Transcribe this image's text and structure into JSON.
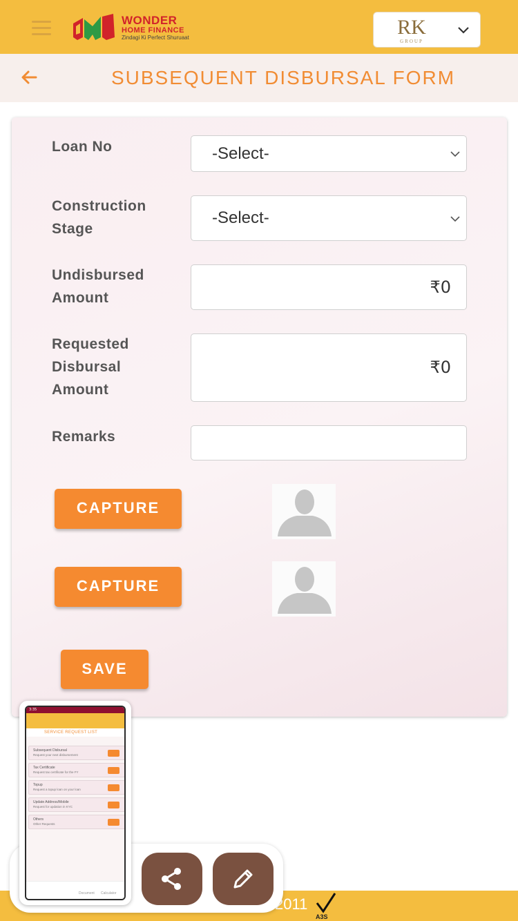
{
  "header": {
    "brand_main": "WONDER",
    "brand_sub": "HOME FINANCE",
    "brand_tagline": "Zindagi Ki Perfect Shuruaat",
    "group_logo_text": "RK",
    "group_logo_sub": "GROUP"
  },
  "page": {
    "title": "SUBSEQUENT DISBURSAL FORM"
  },
  "form": {
    "loan_no": {
      "label": "Loan No",
      "value": "-Select-"
    },
    "construction_stage": {
      "label_line1": "Construction",
      "label_line2": "Stage",
      "value": "-Select-"
    },
    "undisbursed_amount": {
      "label_line1": "Undisbursed",
      "label_line2": "Amount",
      "value": "₹0"
    },
    "requested_amount": {
      "label_line1": "Requested",
      "label_line2": "Disbursal",
      "label_line3": "Amount",
      "value": "₹0"
    },
    "remarks": {
      "label": "Remarks",
      "value": ""
    },
    "capture_label_1": "CAPTURE",
    "capture_label_2": "CAPTURE",
    "save_label": "SAVE"
  },
  "thumbnail": {
    "status": "3:35",
    "title": "SERVICE REQUEST LIST",
    "items": [
      {
        "title": "Subsequent Disbursal",
        "subtitle": "Request your next disbursement"
      },
      {
        "title": "Tax Certificate",
        "subtitle": "Request tax certificate for the FY"
      },
      {
        "title": "Topup",
        "subtitle": "Request a topup loan on your loan"
      },
      {
        "title": "Update Address/Mobile",
        "subtitle": "Request for updation in KYC"
      },
      {
        "title": "Others",
        "subtitle": "Other Requests"
      }
    ],
    "nav_1": "Document",
    "nav_2": "Calculator"
  },
  "footer": {
    "text": "2011",
    "badge": "A3S"
  },
  "colors": {
    "header_bg": "#f4bd3f",
    "accent_orange": "#f58a30",
    "title_orange": "#f18c33",
    "fab_brown": "#7a5140"
  },
  "icons": {
    "menu": "hamburger-icon",
    "back": "arrow-left-icon",
    "dropdown": "chevron-down-icon",
    "share": "share-icon",
    "edit": "pencil-icon",
    "avatar": "user-placeholder-icon"
  }
}
